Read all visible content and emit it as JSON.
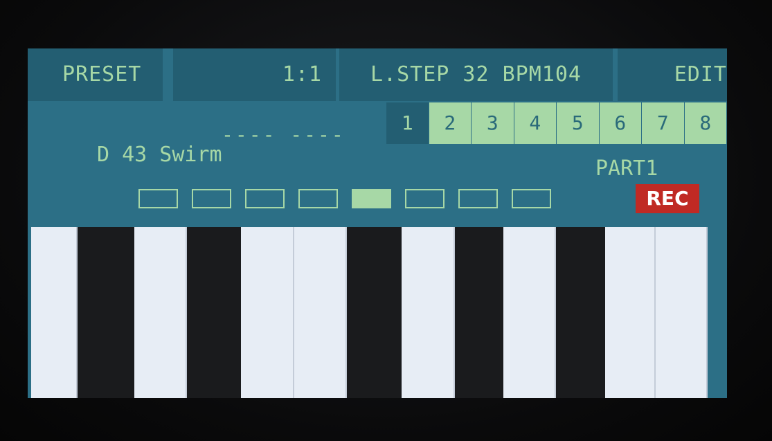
{
  "header": {
    "preset_label": "PRESET",
    "position": "1:1",
    "step_bpm": "L.STEP 32 BPM104",
    "edit_label": "EDIT"
  },
  "tracks": [
    "1",
    "2",
    "3",
    "4",
    "5",
    "6",
    "7",
    "8"
  ],
  "active_track": "1",
  "pattern_dashes": "---- ----",
  "sound_name": "D 43 Swirm",
  "part_label": "PART1",
  "rec_label": "REC",
  "step_pages": {
    "count": 8,
    "active_index": 4
  },
  "keyboard": {
    "keys": [
      "white",
      "black",
      "white",
      "black",
      "white",
      "white",
      "black",
      "white",
      "black",
      "white",
      "black",
      "white",
      "white"
    ]
  },
  "colors": {
    "screen_bg": "#2c6f86",
    "panel_bg": "#235e72",
    "accent_green": "#a7d8a6",
    "rec_red": "#c02a24"
  }
}
